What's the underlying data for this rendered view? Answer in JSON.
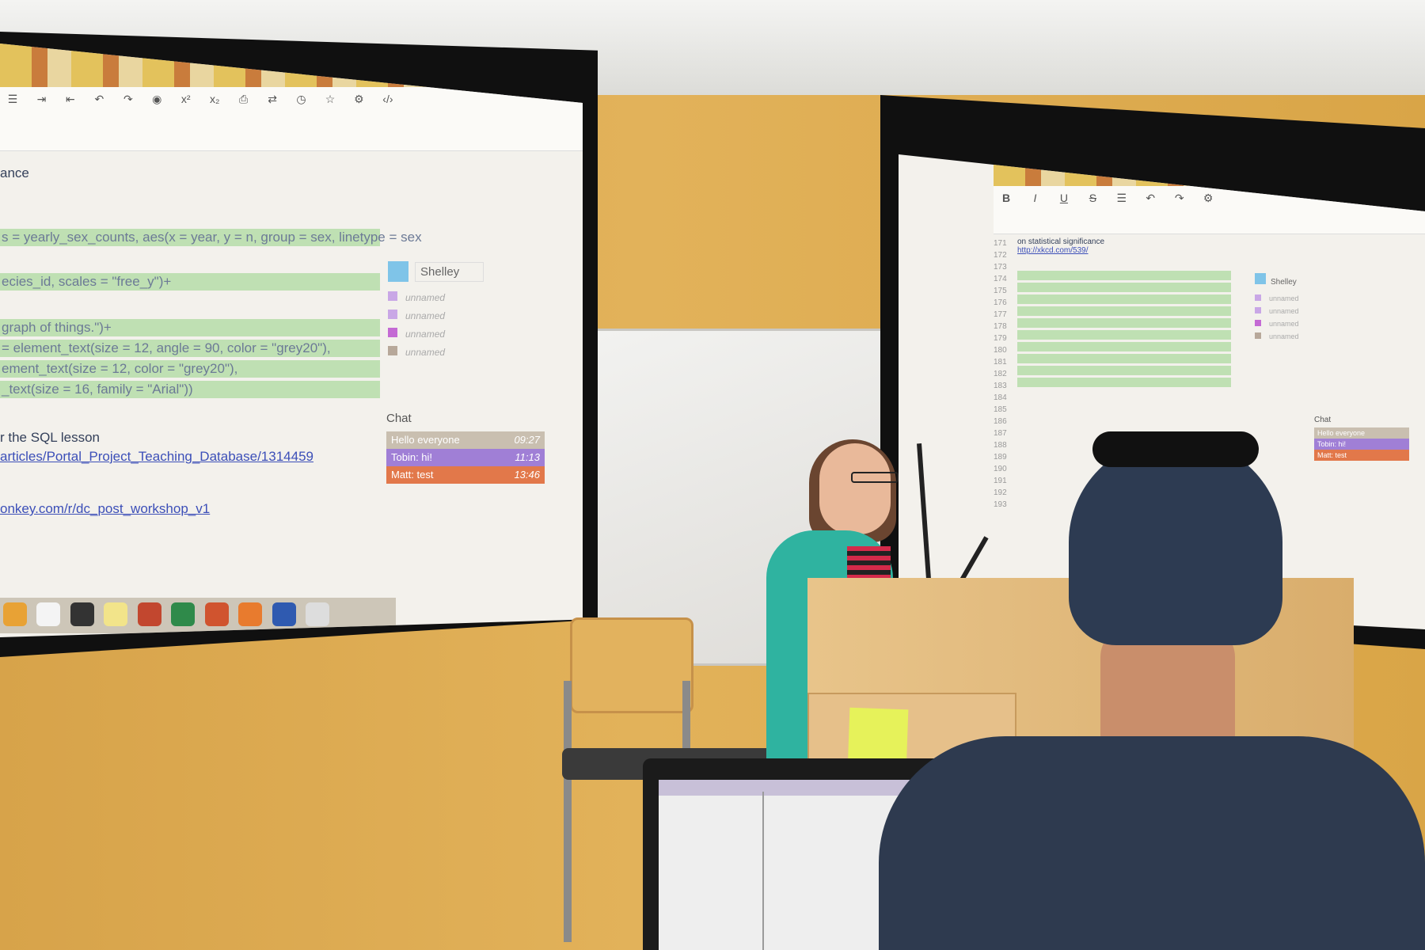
{
  "left_screen": {
    "collaborator": "Shelley",
    "unnamed_label": "unnamed",
    "code_lines": [
      "s = yearly_sex_counts, aes(x = year, y = n, group = sex, linetype = sex",
      "ecies_id, scales = \"free_y\")+",
      "graph of things.\")+",
      "= element_text(size = 12, angle = 90, color = \"grey20\"),",
      "ement_text(size = 12, color = \"grey20\"),",
      "_text(size = 16, family = \"Arial\"))"
    ],
    "plain_lines": [
      "ance",
      "r the SQL lesson"
    ],
    "link_lines": [
      "articles/Portal_Project_Teaching_Database/1314459",
      "onkey.com/r/dc_post_workshop_v1"
    ],
    "chat": {
      "title": "Chat",
      "messages": [
        {
          "text": "Hello everyone",
          "time": "09:27",
          "color": "#c9bfb0"
        },
        {
          "text": "Tobin: hi!",
          "time": "11:13",
          "color": "#a07fd6"
        },
        {
          "text": "Matt: test",
          "time": "13:46",
          "color": "#e2784a"
        }
      ]
    }
  },
  "right_screen": {
    "collaborator": "Shelley",
    "unnamed_label": "unnamed",
    "line_numbers": [
      "171",
      "172",
      "173",
      "174",
      "175",
      "176",
      "177",
      "178",
      "179",
      "180",
      "181",
      "182",
      "183",
      "184",
      "185",
      "186",
      "187",
      "188",
      "189",
      "190",
      "191",
      "192",
      "193"
    ],
    "text_lines": [
      "on statistical significance"
    ],
    "link_lines": [
      "http://xkcd.com/539/"
    ],
    "chat": {
      "title": "Chat",
      "messages": [
        {
          "text": "Hello everyone",
          "color": "#c9bfb0"
        },
        {
          "text": "Tobin: hi!",
          "color": "#a07fd6"
        },
        {
          "text": "Matt: test",
          "color": "#e2784a"
        }
      ]
    }
  },
  "colors": {
    "wall": "#e2b25a",
    "code_highlight": "#bfe0b3",
    "link": "#3c4fb8"
  }
}
